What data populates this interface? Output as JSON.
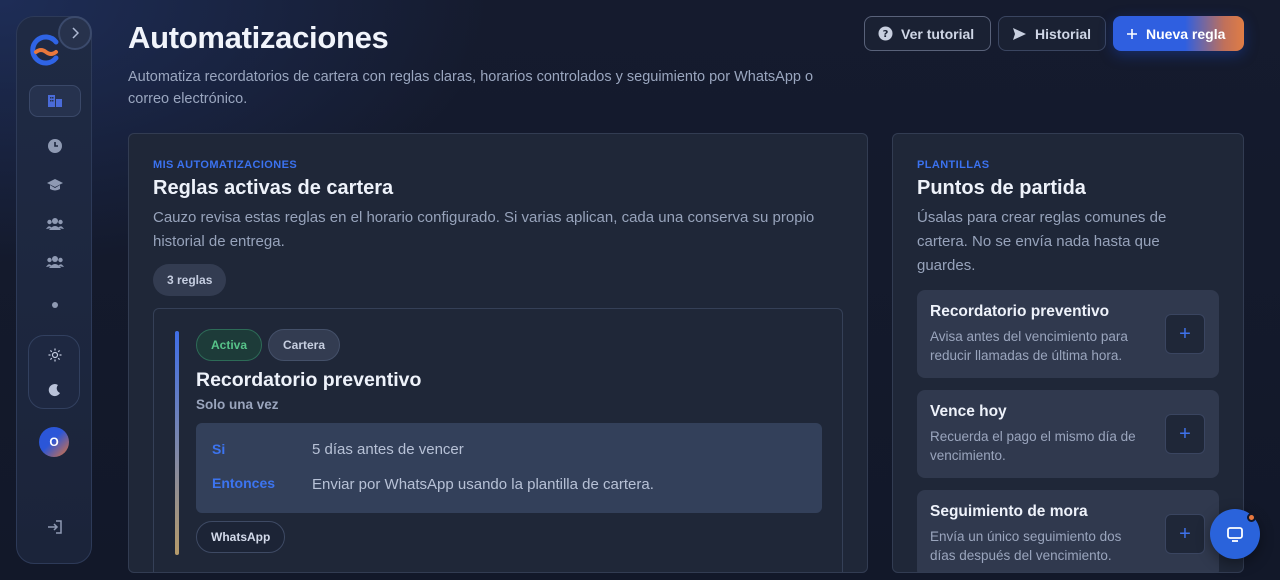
{
  "header": {
    "title": "Automatizaciones",
    "subtitle": "Automatiza recordatorios de cartera con reglas claras, horarios controlados y seguimiento por WhatsApp o correo electrónico.",
    "buttons": {
      "tutorial": "Ver tutorial",
      "history": "Historial",
      "new_rule": "Nueva regla"
    }
  },
  "sidebar": {
    "avatar_initial": "O",
    "icons": [
      "building-icon",
      "clock-icon",
      "graduation-cap-icon",
      "users-icon",
      "users-group-icon",
      "dot-icon",
      "sun-icon",
      "moon-icon",
      "logout-icon"
    ]
  },
  "main_panel": {
    "eyebrow": "MIS AUTOMATIZACIONES",
    "title": "Reglas activas de cartera",
    "description": "Cauzo revisa estas reglas en el horario configurado. Si varias aplican, cada una conserva su propio historial de entrega.",
    "count": "3 reglas",
    "rule": {
      "status": "Activa",
      "category": "Cartera",
      "name": "Recordatorio preventivo",
      "frequency": "Solo una vez",
      "if_label": "Si",
      "if_value": "5 días antes de vencer",
      "then_label": "Entonces",
      "then_value": "Enviar por WhatsApp usando la plantilla de cartera.",
      "channel": "WhatsApp"
    }
  },
  "templates_panel": {
    "eyebrow": "PLANTILLAS",
    "title": "Puntos de partida",
    "description": "Úsalas para crear reglas comunes de cartera. No se envía nada hasta que guardes.",
    "items": [
      {
        "title": "Recordatorio preventivo",
        "desc": "Avisa antes del vencimiento para reducir llamadas de última hora."
      },
      {
        "title": "Vence hoy",
        "desc": "Recuerda el pago el mismo día de vencimiento."
      },
      {
        "title": "Seguimiento de mora",
        "desc": "Envía un único seguimiento dos días después del vencimiento."
      }
    ]
  },
  "colors": {
    "accent": "#2f5fe0",
    "active_green": "#57c389",
    "brand_orange": "#e07d45"
  }
}
